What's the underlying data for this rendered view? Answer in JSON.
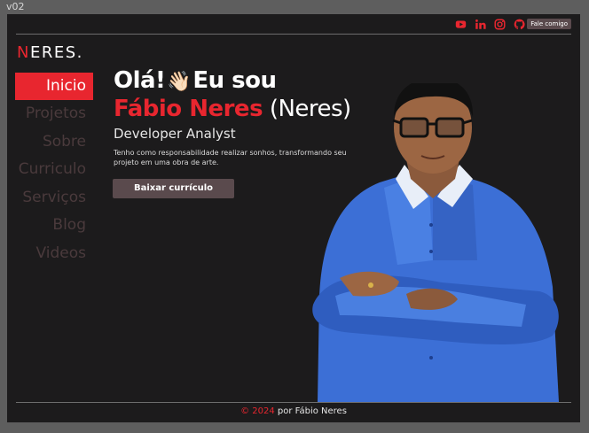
{
  "version_label": "v02",
  "header": {
    "socials": [
      {
        "icon": "youtube-icon",
        "color": "#e8262f"
      },
      {
        "icon": "linkedin-icon",
        "color": "#e8262f"
      },
      {
        "icon": "instagram-icon",
        "color": "#e8262f"
      },
      {
        "icon": "github-icon",
        "color": "#e8262f"
      }
    ],
    "contact_label": "Fale comigo"
  },
  "logo": {
    "accent": "N",
    "rest": "ERES."
  },
  "nav": {
    "items": [
      {
        "label": "Inicio",
        "active": true
      },
      {
        "label": "Projetos",
        "active": false
      },
      {
        "label": "Sobre",
        "active": false
      },
      {
        "label": "Curriculo",
        "active": false
      },
      {
        "label": "Serviços",
        "active": false
      },
      {
        "label": "Blog",
        "active": false
      },
      {
        "label": "Videos",
        "active": false
      }
    ]
  },
  "hero": {
    "greeting": "Olá!",
    "wave": "👋🏻",
    "intro": "Eu sou",
    "name": "Fábio Neres",
    "nickname": "(Neres)",
    "role": "Developer Analyst",
    "description": "Tenho como responsabilidade realizar sonhos, transformando seu projeto em uma obra de arte.",
    "cta_label": "Baixar currículo"
  },
  "footer": {
    "copyright": "©",
    "year": "2024",
    "text": "por Fábio Neres"
  },
  "colors": {
    "accent": "#e8262f",
    "background": "#1c1b1c",
    "button": "#5a4a4d"
  }
}
